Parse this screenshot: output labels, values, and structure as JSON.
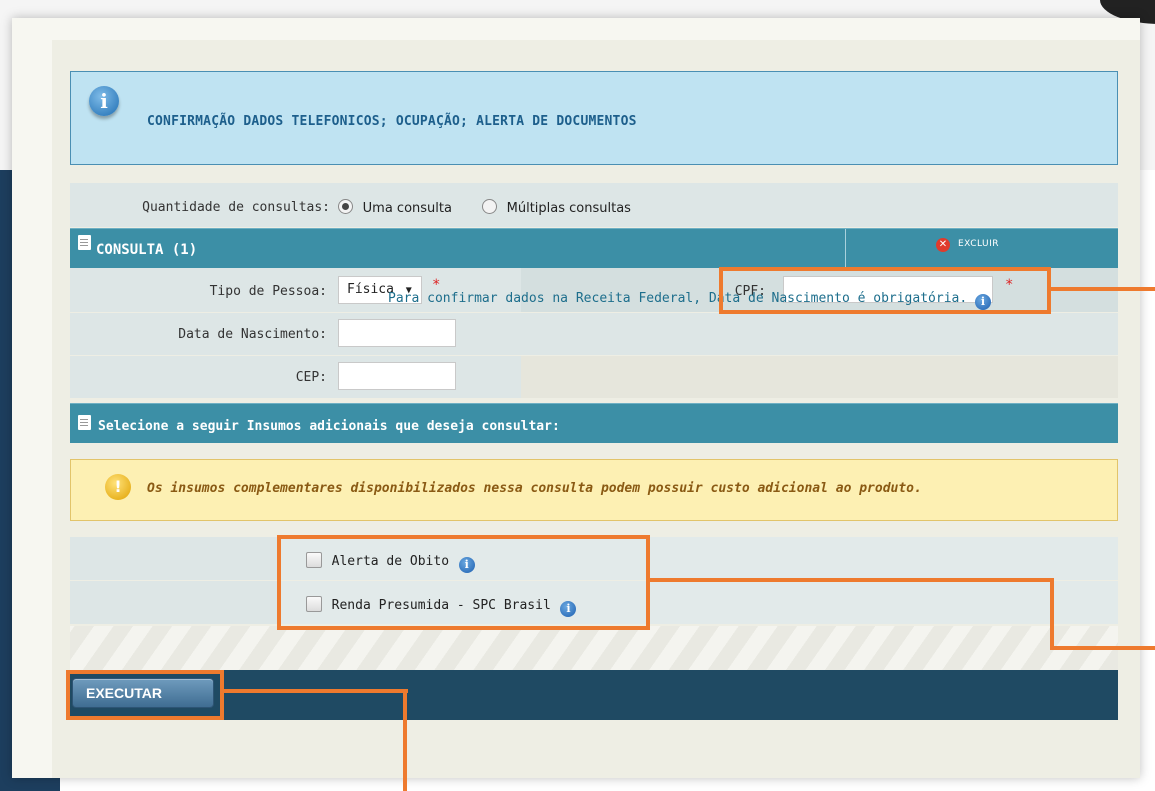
{
  "banner": {
    "title": "CONFIRMAÇÃO DADOS TELEFONICOS; OCUPAÇÃO; ALERTA DE DOCUMENTOS",
    "icon": "info-icon"
  },
  "quantity": {
    "label": "Quantidade de consultas:",
    "options": [
      {
        "label": "Uma consulta",
        "selected": true
      },
      {
        "label": "Múltiplas consultas",
        "selected": false
      }
    ]
  },
  "consulta": {
    "title": "CONSULTA (1)",
    "excluir_label": "EXCLUIR"
  },
  "form": {
    "tipo_pessoa_label": "Tipo de Pessoa:",
    "tipo_pessoa_value": "Física",
    "cpf_label": "CPF:",
    "cpf_value": "",
    "nascimento_label": "Data de Nascimento:",
    "nascimento_value": "",
    "nascimento_note": "Para confirmar dados na Receita Federal, Data de Nascimento é obrigatória.",
    "cep_label": "CEP:",
    "cep_value": "",
    "required_mark": "*"
  },
  "insumos": {
    "title": "Selecione a seguir Insumos adicionais que deseja consultar:"
  },
  "warning": {
    "text": "Os insumos complementares disponibilizados nessa consulta podem possuir custo adicional ao produto."
  },
  "options": [
    {
      "label": "Alerta de Obito",
      "checked": false
    },
    {
      "label": "Renda Presumida - SPC Brasil",
      "checked": false
    }
  ],
  "execute_label": "EXECUTAR",
  "colors": {
    "highlight": "#ee7a2e",
    "header_bar": "#3c8fa6",
    "exec_bar": "#1f4a63"
  }
}
